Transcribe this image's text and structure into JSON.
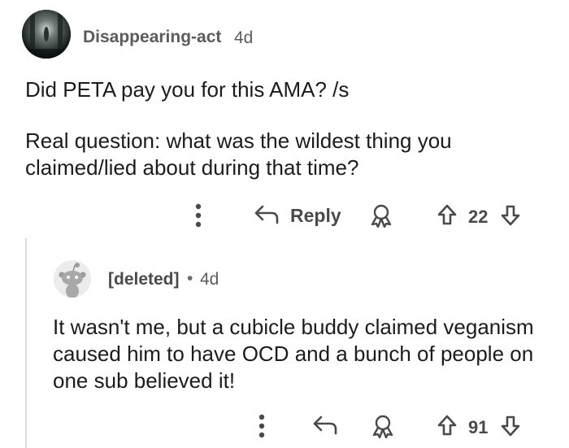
{
  "parent": {
    "author": "Disappearing-act",
    "age": "4d",
    "body_line1": "Did PETA pay you for this AMA? /s",
    "body_line2": "Real question: what was the wildest thing you claimed/lied about during that time?",
    "actions": {
      "more_icon": "vertical-dots-icon",
      "reply_label": "Reply",
      "award_icon": "award-icon",
      "upvote_icon": "upvote-arrow-icon",
      "vote_count": "22",
      "downvote_icon": "downvote-arrow-icon"
    }
  },
  "reply": {
    "author": "[deleted]",
    "separator": "•",
    "age": "4d",
    "body": "It wasn't me, but a cubicle buddy claimed veganism caused him to have OCD and a bunch of people on one sub believed it!",
    "actions": {
      "more_icon": "vertical-dots-icon",
      "reply_icon": "reply-arrow-icon",
      "award_icon": "award-icon",
      "upvote_icon": "upvote-arrow-icon",
      "vote_count": "91",
      "downvote_icon": "downvote-arrow-icon"
    }
  },
  "colors": {
    "text": "#1c1c1c",
    "meta": "#5c5c5c",
    "icon": "#4a4a4a",
    "thread_line": "#dcdcdc"
  }
}
